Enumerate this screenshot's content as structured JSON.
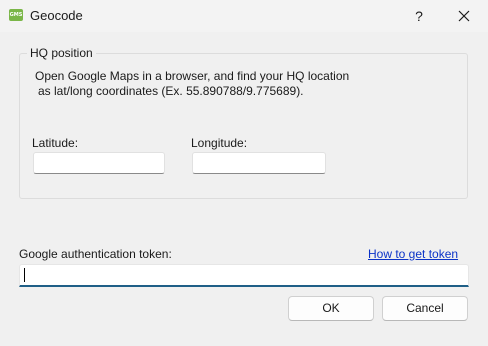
{
  "window": {
    "icon_text": "GMS",
    "title": "Geocode",
    "help_label": "?"
  },
  "hq_group": {
    "legend": "HQ position",
    "info_line_1": "Open Google Maps in a browser, and find your HQ location",
    "info_line_2": "as lat/long coordinates (Ex. 55.890788/9.775689).",
    "latitude_label": "Latitude:",
    "latitude_value": "",
    "longitude_label": "Longitude:",
    "longitude_value": ""
  },
  "token": {
    "label": "Google authentication token:",
    "link": "How to get token",
    "value": ""
  },
  "buttons": {
    "ok": "OK",
    "cancel": "Cancel"
  }
}
